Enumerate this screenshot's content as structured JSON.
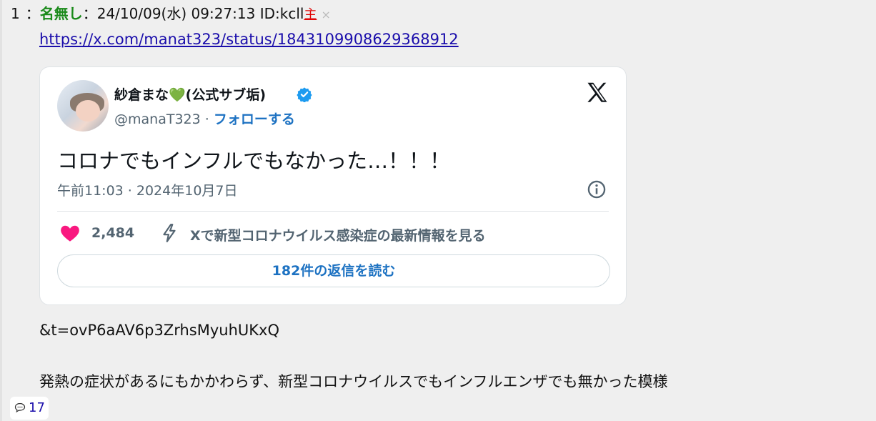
{
  "post": {
    "number": "1",
    "separator": "：",
    "name": "名無し",
    "meta": "：24/10/09(水) 09:27:13 ID:kcll",
    "owner_mark": "主",
    "close_mark": "×",
    "link": "https://x.com/manat323/status/1843109908629368912",
    "query": "&t=ovP6aAV6p3ZrhsMyuhUKxQ",
    "comment": "発熱の症状があるにもかかわらず、新型コロナウイルスでもインフルエンザでも無かった模様",
    "reply_count": "17"
  },
  "tweet": {
    "display_name": "紗倉まな💚(公式サブ垢)",
    "handle": "@manaT323",
    "dot": " · ",
    "follow_label": "フォローする",
    "text": "コロナでもインフルでもなかった…！！！",
    "timestamp": "午前11:03 · 2024年10月7日",
    "likes": "2,484",
    "info_link": "Xで新型コロナウイルス感染症の最新情報を見る",
    "replies_button": "182件の返信を読む"
  },
  "colors": {
    "background": "#efefef",
    "name_green": "#1a8a1a",
    "link_blue": "#1a0dab",
    "x_blue": "#1d72c2",
    "heart_pink": "#f91880",
    "verified_blue": "#1d9bf0"
  }
}
